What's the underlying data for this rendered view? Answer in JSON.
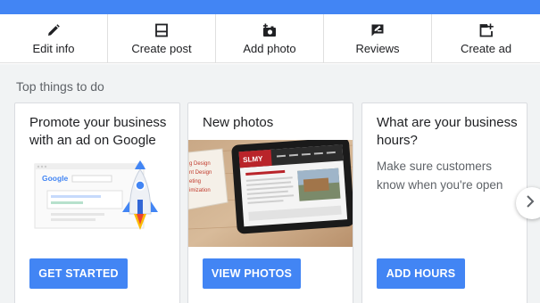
{
  "actions": [
    {
      "label": "Edit info",
      "icon": "pencil-icon"
    },
    {
      "label": "Create post",
      "icon": "post-icon"
    },
    {
      "label": "Add photo",
      "icon": "add-photo-icon"
    },
    {
      "label": "Reviews",
      "icon": "reviews-icon"
    },
    {
      "label": "Create ad",
      "icon": "create-ad-icon"
    }
  ],
  "section_title": "Top things to do",
  "cards": [
    {
      "title": "Promote your business with an ad on Google",
      "button": "GET STARTED",
      "illustration": "google-ad-rocket-illustration",
      "illustration_text": "Google"
    },
    {
      "title": "New photos",
      "button": "VIEW PHOTOS",
      "illustration": "tablet-website-photo",
      "illustration_text": [
        "g Design",
        "nt Design",
        "eting",
        "imization"
      ],
      "logo_text": "SLMY"
    },
    {
      "title": "What are your business hours?",
      "description": "Make sure customers know when you're open",
      "button": "ADD HOURS"
    }
  ],
  "colors": {
    "accent": "#4285f4",
    "background": "#f1f3f4",
    "rocket_red": "#ea4335",
    "rocket_yellow": "#fbbc04"
  },
  "next_icon": "chevron-right-icon"
}
